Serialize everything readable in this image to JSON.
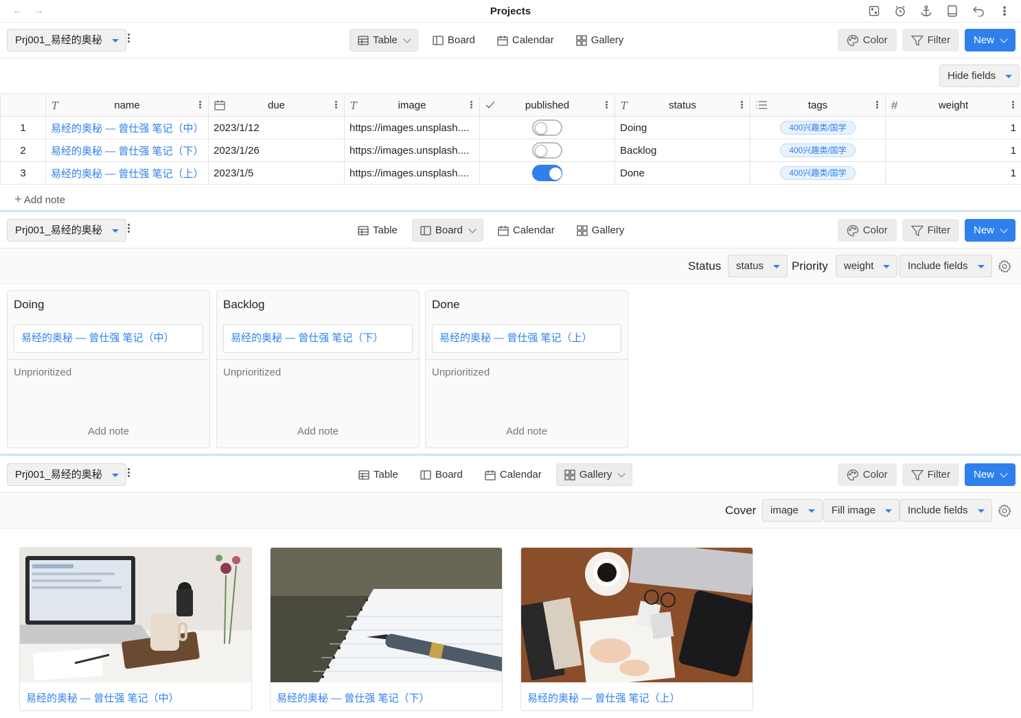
{
  "window": {
    "title": "Projects"
  },
  "project_name": "Prj001_易经的奥秘",
  "views": {
    "table": "Table",
    "board": "Board",
    "calendar": "Calendar",
    "gallery": "Gallery"
  },
  "actions": {
    "color": "Color",
    "filter": "Filter",
    "new": "New"
  },
  "table": {
    "hide_fields": "Hide fields",
    "columns": {
      "name": "name",
      "due": "due",
      "image": "image",
      "published": "published",
      "status": "status",
      "tags": "tags",
      "weight": "weight"
    },
    "rows": [
      {
        "index": "1",
        "name": "易经的奥秘 — 曾仕强 笔记（中）",
        "due": "2023/1/12",
        "image": "https://images.unsplash....",
        "published": false,
        "status": "Doing",
        "tags": "400兴趣类/国学",
        "weight": "1"
      },
      {
        "index": "2",
        "name": "易经的奥秘 — 曾仕强 笔记（下）",
        "due": "2023/1/26",
        "image": "https://images.unsplash....",
        "published": false,
        "status": "Backlog",
        "tags": "400兴趣类/国学",
        "weight": "1"
      },
      {
        "index": "3",
        "name": "易经的奥秘 — 曾仕强 笔记（上）",
        "due": "2023/1/5",
        "image": "https://images.unsplash....",
        "published": true,
        "status": "Done",
        "tags": "400兴趣类/国学",
        "weight": "1"
      }
    ],
    "add_note": "Add note"
  },
  "board": {
    "status_label": "Status",
    "status_value": "status",
    "priority_label": "Priority",
    "priority_value": "weight",
    "include_fields": "Include fields",
    "columns": [
      {
        "title": "Doing",
        "card": "易经的奥秘 — 曾仕强 笔记（中）",
        "group": "Unprioritized",
        "add_note": "Add note"
      },
      {
        "title": "Backlog",
        "card": "易经的奥秘 — 曾仕强 笔记（下）",
        "group": "Unprioritized",
        "add_note": "Add note"
      },
      {
        "title": "Done",
        "card": "易经的奥秘 — 曾仕强 笔记（上）",
        "group": "Unprioritized",
        "add_note": "Add note"
      }
    ]
  },
  "gallery": {
    "cover_label": "Cover",
    "cover_value": "image",
    "fit_value": "Fill image",
    "include_fields": "Include fields",
    "cards": [
      {
        "caption": "易经的奥秘 — 曾仕强 笔记（中）"
      },
      {
        "caption": "易经的奥秘 — 曾仕强 笔记（下）"
      },
      {
        "caption": "易经的奥秘 — 曾仕强 笔记（上）"
      }
    ]
  },
  "colors": {
    "accent": "#2f80ed",
    "tag_bg": "#e8f2fd"
  }
}
